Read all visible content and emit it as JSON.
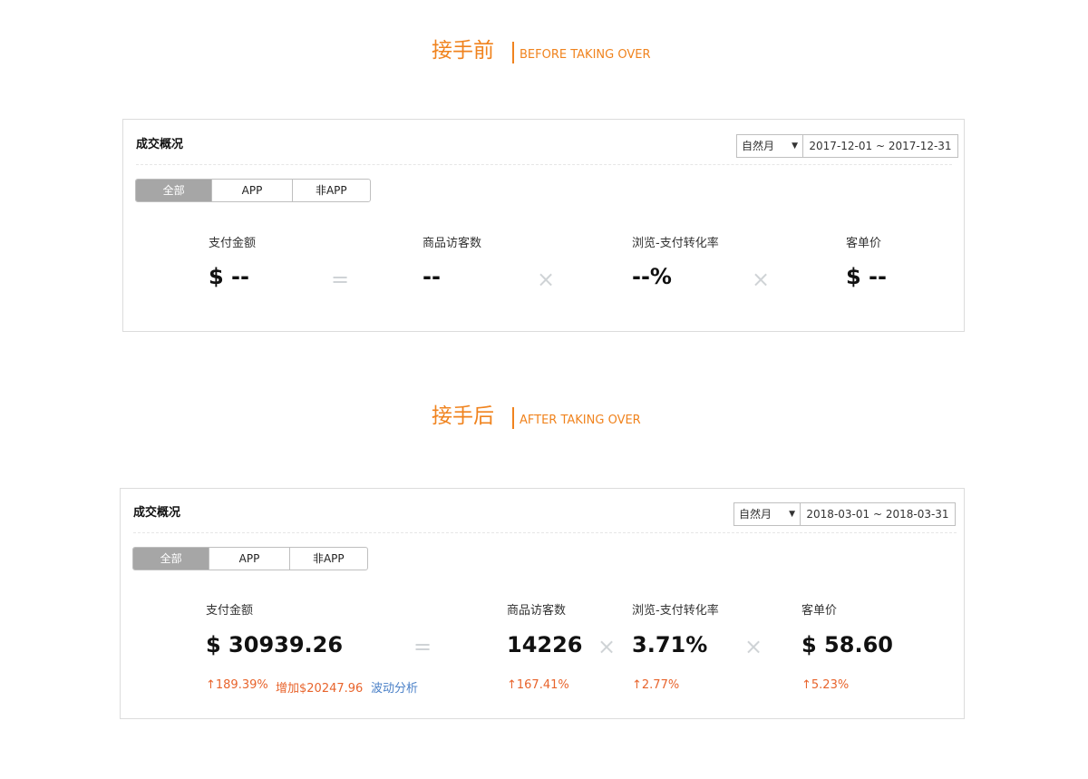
{
  "before": {
    "heading_cn": "接手前",
    "heading_en": "BEFORE TAKING OVER",
    "panel_title": "成交概况",
    "period_select": "自然月",
    "date_range": "2017-12-01 ~ 2017-12-31",
    "tabs": [
      "全部",
      "APP",
      "非APP"
    ],
    "metrics": [
      {
        "label": "支付金额",
        "value": "$ --"
      },
      {
        "label": "商品访客数",
        "value": "--"
      },
      {
        "label": "浏览-支付转化率",
        "value": "--%"
      },
      {
        "label": "客单价",
        "value": "$ --"
      }
    ],
    "operators": [
      "=",
      "×",
      "×"
    ]
  },
  "after": {
    "heading_cn": "接手后",
    "heading_en": "AFTER TAKING OVER",
    "panel_title": "成交概况",
    "period_select": "自然月",
    "date_range": "2018-03-01 ~ 2018-03-31",
    "tabs": [
      "全部",
      "APP",
      "非APP"
    ],
    "metrics": [
      {
        "label": "支付金额",
        "value": "$ 30939.26",
        "change": "↑189.39%",
        "increase": "增加$20247.96",
        "link": "波动分析"
      },
      {
        "label": "商品访客数",
        "value": "14226",
        "change": "↑167.41%"
      },
      {
        "label": "浏览-支付转化率",
        "value": "3.71%",
        "change": "↑2.77%"
      },
      {
        "label": "客单价",
        "value": "$ 58.60",
        "change": "↑5.23%"
      }
    ],
    "operators": [
      "=",
      "×",
      "×"
    ]
  },
  "colors": {
    "accent": "#f0831e",
    "positive_change": "#e8642c",
    "link": "#4a80c7",
    "active_tab": "#a6a6a6",
    "operator": "#cfd3d6"
  },
  "icons": {
    "dropdown": "caret-down-icon"
  }
}
